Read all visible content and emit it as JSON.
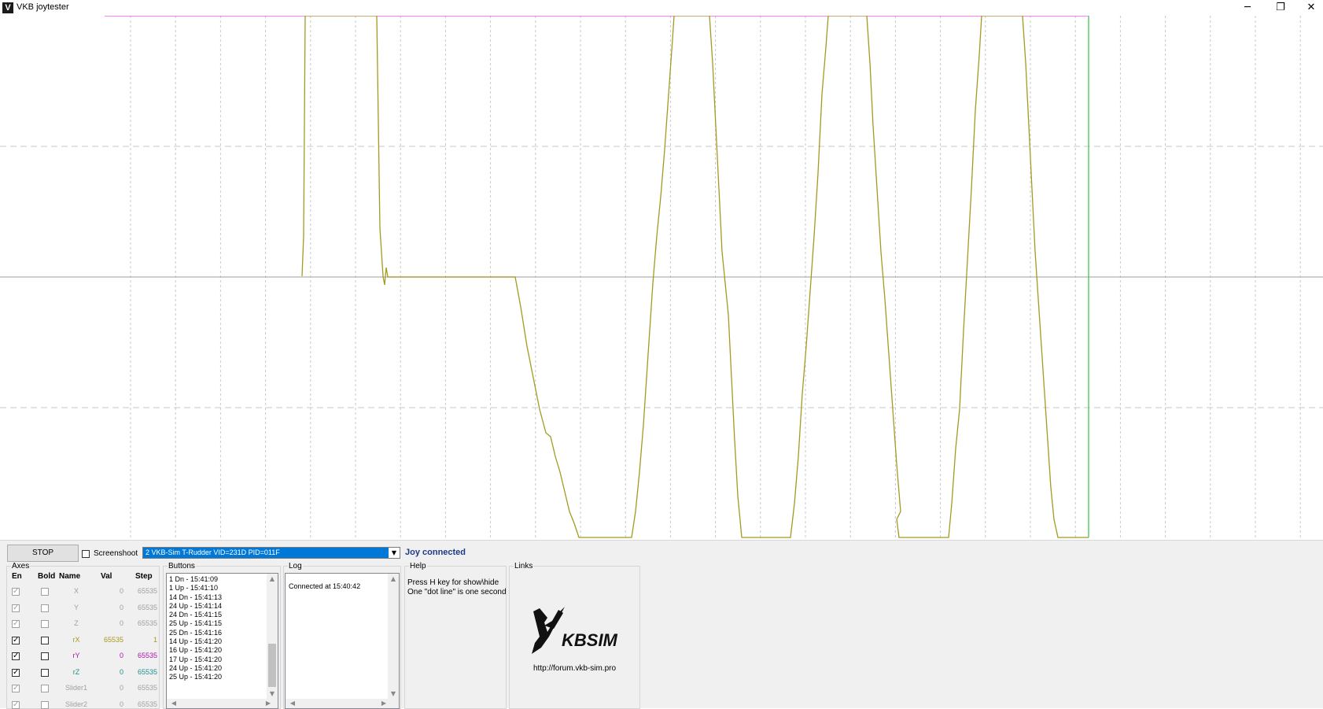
{
  "window": {
    "title": "VKB joytester",
    "minimize_glyph": "─",
    "restore_glyph": "❐",
    "close_glyph": "✕"
  },
  "colors": {
    "trace_rx": "#a39b1e",
    "limit_line": "#ff33ff",
    "cursor_line": "#33c24a",
    "center_line": "#b0b0b0",
    "grid": "#c8c8c8",
    "status_text": "#1d3a87"
  },
  "controls": {
    "stop_label": "STOP",
    "screenshot_label": "Screenshoot",
    "device_value": "2  VKB-Sim T-Rudder  VID=231D PID=011F",
    "status_text": "Joy connected"
  },
  "axes_panel": {
    "title": "Axes",
    "headers": {
      "en": "En",
      "bold": "Bold",
      "name": "Name",
      "val": "Val",
      "step": "Step"
    },
    "rows": [
      {
        "name": "X",
        "val": "0",
        "step": "65535",
        "enabled": true,
        "active": false,
        "color": "#a0a0a0"
      },
      {
        "name": "Y",
        "val": "0",
        "step": "65535",
        "enabled": true,
        "active": false,
        "color": "#a0a0a0"
      },
      {
        "name": "Z",
        "val": "0",
        "step": "65535",
        "enabled": true,
        "active": false,
        "color": "#a0a0a0"
      },
      {
        "name": "rX",
        "val": "65535",
        "step": "1",
        "enabled": true,
        "active": true,
        "color": "#a39b1e"
      },
      {
        "name": "rY",
        "val": "0",
        "step": "65535",
        "enabled": true,
        "active": true,
        "color": "#b012b0"
      },
      {
        "name": "rZ",
        "val": "0",
        "step": "65535",
        "enabled": true,
        "active": true,
        "color": "#1e8f8f"
      },
      {
        "name": "Slider1",
        "val": "0",
        "step": "65535",
        "enabled": true,
        "active": false,
        "color": "#a0a0a0"
      },
      {
        "name": "Slider2",
        "val": "0",
        "step": "65535",
        "enabled": true,
        "active": false,
        "color": "#a0a0a0"
      }
    ]
  },
  "buttons_panel": {
    "title": "Buttons",
    "events": [
      "1 Dn - 15:41:09",
      "1 Up - 15:41:10",
      "14 Dn - 15:41:13",
      "24 Up - 15:41:14",
      "24 Dn - 15:41:15",
      "25 Up - 15:41:15",
      "25 Dn - 15:41:16",
      "14 Up - 15:41:20",
      "16 Up - 15:41:20",
      "17 Up - 15:41:20",
      "24 Up - 15:41:20",
      "25 Up - 15:41:20"
    ]
  },
  "log_panel": {
    "title": "Log",
    "lines": [
      "Connected at 15:40:42"
    ]
  },
  "help_panel": {
    "title": "Help",
    "lines": [
      "Press H key for show\\hide",
      "One \"dot line\" is one second"
    ]
  },
  "links_panel": {
    "title": "Links",
    "logo_text": "KBSIM",
    "url": "http://forum.vkb-sim.pro"
  }
}
